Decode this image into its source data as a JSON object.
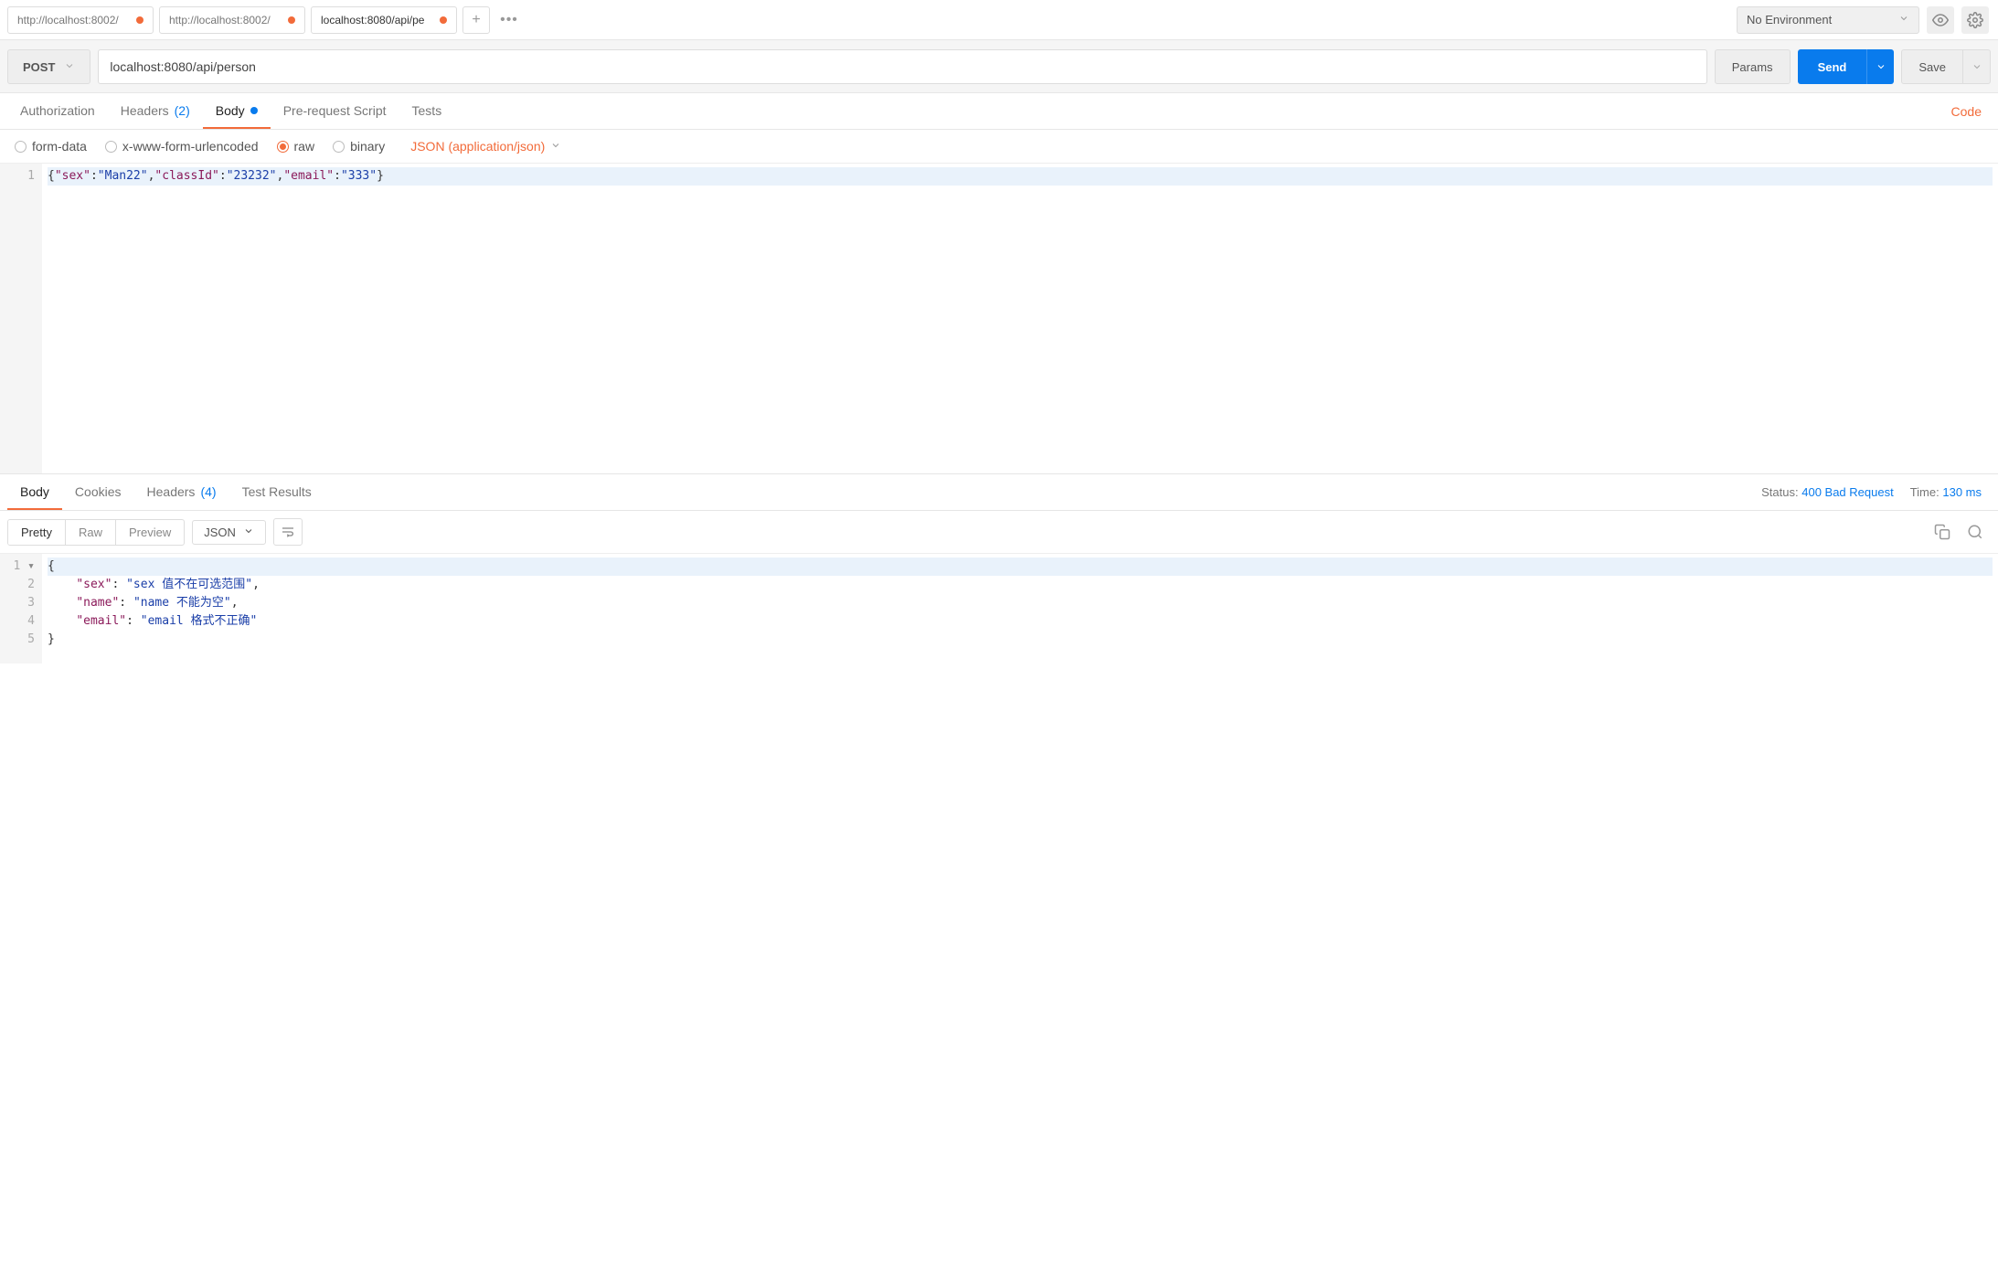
{
  "tabs": [
    {
      "title": "http://localhost:8002/",
      "dirty": true
    },
    {
      "title": "http://localhost:8002/",
      "dirty": true
    },
    {
      "title": "localhost:8080/api/pe",
      "dirty": true
    }
  ],
  "environment": {
    "label": "No Environment"
  },
  "request": {
    "method": "POST",
    "url": "localhost:8080/api/person",
    "params_button": "Params",
    "send_button": "Send",
    "save_button": "Save"
  },
  "request_tabs": {
    "authorization": "Authorization",
    "headers": "Headers",
    "headers_count": "(2)",
    "body": "Body",
    "prerequest": "Pre-request Script",
    "tests": "Tests",
    "code_link": "Code"
  },
  "body_types": {
    "form_data": "form-data",
    "urlencoded": "x-www-form-urlencoded",
    "raw": "raw",
    "binary": "binary",
    "content_type": "JSON (application/json)"
  },
  "request_body": {
    "lines": [
      "1"
    ],
    "tokens": {
      "k_sex": "\"sex\"",
      "v_sex": "\"Man22\"",
      "k_classId": "\"classId\"",
      "v_classId": "\"23232\"",
      "k_email": "\"email\"",
      "v_email": "\"333\""
    }
  },
  "response_tabs": {
    "body": "Body",
    "cookies": "Cookies",
    "headers": "Headers",
    "headers_count": "(4)",
    "test_results": "Test Results"
  },
  "response_status": {
    "status_label": "Status:",
    "status_value": "400 Bad Request",
    "time_label": "Time:",
    "time_value": "130 ms"
  },
  "response_view": {
    "pretty": "Pretty",
    "raw": "Raw",
    "preview": "Preview",
    "format": "JSON"
  },
  "response_body": {
    "line_nums": [
      "1",
      "2",
      "3",
      "4",
      "5"
    ],
    "tokens": {
      "k_sex": "\"sex\"",
      "v_sex": "\"sex 值不在可选范围\"",
      "k_name": "\"name\"",
      "v_name": "\"name 不能为空\"",
      "k_email": "\"email\"",
      "v_email": "\"email 格式不正确\""
    }
  }
}
